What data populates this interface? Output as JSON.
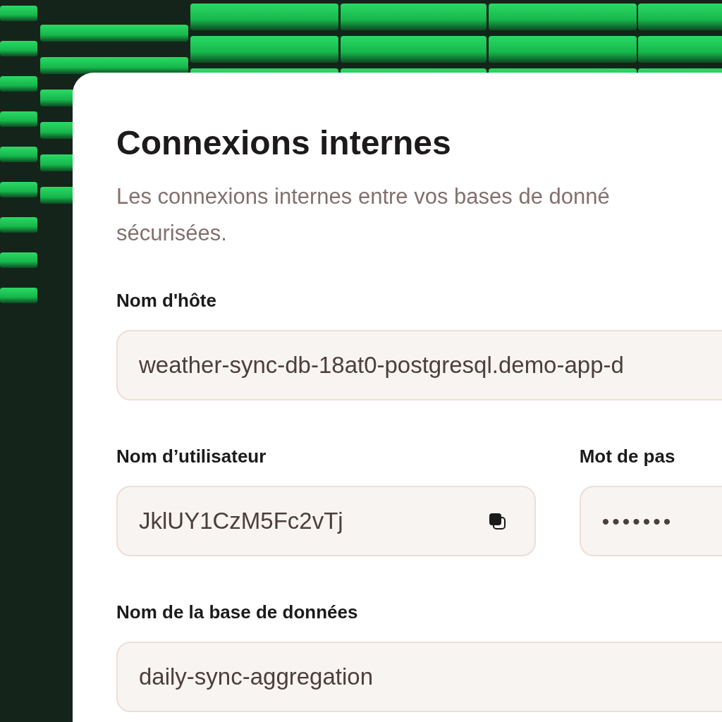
{
  "card": {
    "title": "Connexions internes",
    "description": "Les connexions internes entre vos bases de donné\nsécurisées."
  },
  "fields": [
    {
      "label": "Nom d'hôte",
      "value": "weather-sync-db-18at0-postgresql.demo-app-d",
      "kind": "text"
    },
    {
      "label": "Nom d’utilisateur",
      "value": "JklUY1CzM5Fc2vTj",
      "kind": "text",
      "copy": true
    },
    {
      "label": "Mot de pas",
      "value": "•••••••",
      "kind": "secret"
    },
    {
      "label": "Nom de la base de données",
      "value": "daily-sync-aggregation",
      "kind": "text"
    }
  ]
}
